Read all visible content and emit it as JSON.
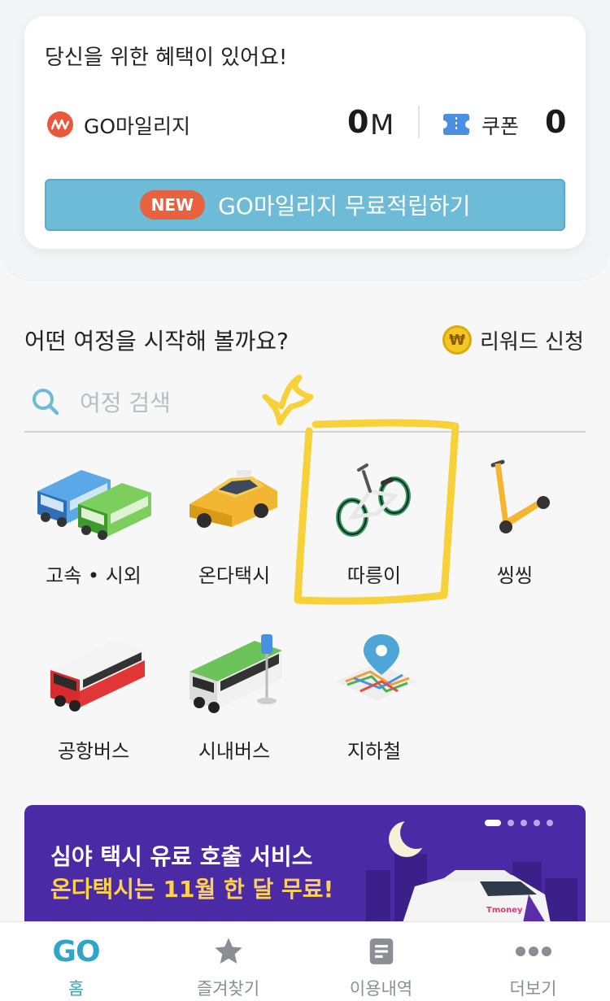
{
  "benefits": {
    "title": "당신을 위한 혜택이 있어요!",
    "mileage_label": "GO마일리지",
    "mileage_value": "0",
    "mileage_unit": "M",
    "coupon_label": "쿠폰",
    "coupon_value": "0",
    "new_badge": "NEW",
    "free_mileage_button": "GO마일리지 무료적립하기"
  },
  "journey": {
    "title": "어떤 여정을 시작해 볼까요?",
    "reward_coin": "₩",
    "reward_label": "리워드 신청",
    "search_placeholder": "여정 검색"
  },
  "transport": [
    {
      "label": "고속 • 시외",
      "icon": "intercity-bus-icon"
    },
    {
      "label": "온다택시",
      "icon": "taxi-icon"
    },
    {
      "label": "따릉이",
      "icon": "bicycle-icon"
    },
    {
      "label": "씽씽",
      "icon": "scooter-icon"
    },
    {
      "label": "공항버스",
      "icon": "airport-bus-icon"
    },
    {
      "label": "시내버스",
      "icon": "city-bus-icon"
    },
    {
      "label": "지하철",
      "icon": "subway-map-icon"
    }
  ],
  "banner": {
    "line1": "심야 택시 유료 호출 서비스",
    "line2": "온다택시는 11월 한 달 무료!",
    "taxi_brand": "Tmoney",
    "pages": 5,
    "active_page": 1
  },
  "bottom_nav": [
    {
      "label": "홈",
      "icon": "go-logo-icon",
      "logo_text": "GO",
      "active": true
    },
    {
      "label": "즐겨찾기",
      "icon": "star-icon",
      "active": false
    },
    {
      "label": "이용내역",
      "icon": "document-icon",
      "active": false
    },
    {
      "label": "더보기",
      "icon": "more-dots-icon",
      "active": false
    }
  ],
  "colors": {
    "accent": "#2fa6c9",
    "button": "#6dbbd6",
    "new_badge": "#e8623f",
    "banner_bg": "#4a2aa5",
    "highlight_doodle": "#f7d13a"
  }
}
